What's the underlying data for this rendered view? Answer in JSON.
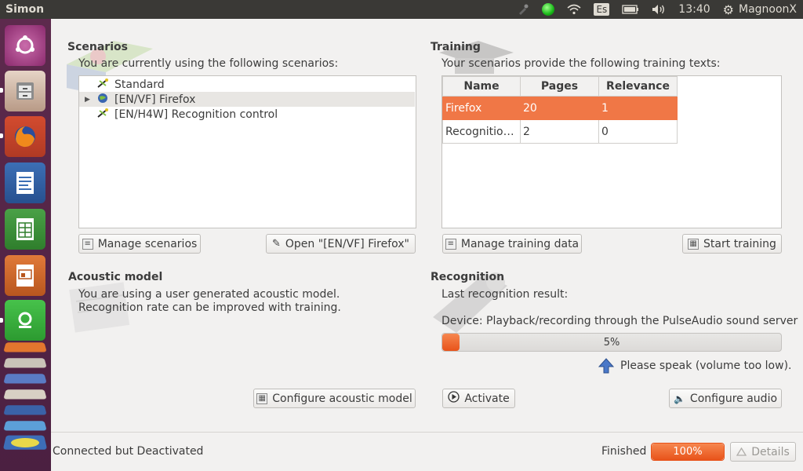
{
  "window": {
    "title": "Simon"
  },
  "tray": {
    "keyboard_layout": "Es",
    "time": "13:40",
    "user": "MagnoonX"
  },
  "launcher": {
    "items": [
      {
        "name": "ubuntu-dash",
        "icon": "ubuntu-logo-icon"
      },
      {
        "name": "files",
        "icon": "file-cabinet-icon"
      },
      {
        "name": "firefox",
        "icon": "firefox-icon"
      },
      {
        "name": "writer",
        "icon": "libreoffice-writer-icon"
      },
      {
        "name": "calc",
        "icon": "libreoffice-calc-icon"
      },
      {
        "name": "impress",
        "icon": "libreoffice-impress-icon"
      },
      {
        "name": "simon",
        "icon": "simon-icon"
      }
    ]
  },
  "scenarios": {
    "title": "Scenarios",
    "description": "You are currently using the following scenarios:",
    "items": [
      {
        "label": "Standard",
        "has_children": false,
        "selected": false
      },
      {
        "label": "[EN/VF] Firefox",
        "has_children": true,
        "selected": true
      },
      {
        "label": "[EN/H4W] Recognition control",
        "has_children": false,
        "selected": false
      }
    ],
    "manage_button": "Manage scenarios",
    "open_button": "Open \"[EN/VF] Firefox\""
  },
  "training": {
    "title": "Training",
    "description": "Your scenarios provide the following training texts:",
    "columns": [
      "Name",
      "Pages",
      "Relevance"
    ],
    "rows": [
      {
        "name": "Firefox",
        "pages": "20",
        "relevance": "1",
        "selected": true
      },
      {
        "name": "Recognitio…",
        "pages": "2",
        "relevance": "0",
        "selected": false
      }
    ],
    "manage_button": "Manage training data",
    "start_button": "Start training"
  },
  "acoustic_model": {
    "title": "Acoustic model",
    "line1": "You are using a user generated acoustic model.",
    "line2": "Recognition rate can be improved with training.",
    "configure_button": "Configure acoustic model"
  },
  "recognition": {
    "title": "Recognition",
    "last_result_label": "Last recognition result:",
    "device_label": "Device: Playback/recording through the PulseAudio sound server",
    "volume_percent": 5,
    "volume_label": "5%",
    "hint": "Please speak (volume too low).",
    "activate_button": "Activate",
    "configure_audio_button": "Configure audio"
  },
  "status_bar": {
    "status": "Connected but Deactivated",
    "finished_label": "Finished",
    "progress_percent": 100,
    "progress_label": "100%",
    "details_button": "Details"
  },
  "colors": {
    "accent": "#f07746",
    "launcher_bg": "#5d2a4d",
    "panel_bg": "#3a3936"
  }
}
